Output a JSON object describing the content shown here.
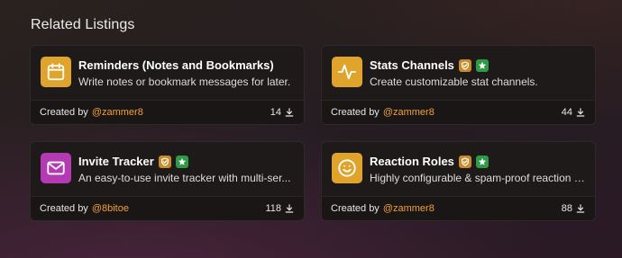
{
  "section_title": "Related Listings",
  "created_prefix": "Created by",
  "colors": {
    "accent_author": "#f0a13a",
    "partner_badge": "#c98b2a",
    "verified_badge": "#2f9a45"
  },
  "listings": [
    {
      "title": "Reminders (Notes and Bookmarks)",
      "description": "Write notes or bookmark messages for later.",
      "author": "@zammer8",
      "downloads": "14",
      "icon": "calendar-icon",
      "icon_color": "#e0a42c",
      "badges": []
    },
    {
      "title": "Stats Channels",
      "description": "Create customizable stat channels.",
      "author": "@zammer8",
      "downloads": "44",
      "icon": "activity-icon",
      "icon_color": "#e0a42c",
      "badges": [
        "partner-badge-icon",
        "verified-badge-icon"
      ]
    },
    {
      "title": "Invite Tracker",
      "description": "An easy-to-use invite tracker with multi-ser...",
      "author": "@8bitoe",
      "downloads": "118",
      "icon": "envelope-icon",
      "icon_color": "#b43ab3",
      "badges": [
        "partner-badge-icon",
        "verified-badge-icon"
      ]
    },
    {
      "title": "Reaction Roles",
      "description": "Highly configurable & spam-proof reaction r...",
      "author": "@zammer8",
      "downloads": "88",
      "icon": "smiley-icon",
      "icon_color": "#e0a42c",
      "badges": [
        "partner-badge-icon",
        "verified-badge-icon"
      ]
    }
  ]
}
